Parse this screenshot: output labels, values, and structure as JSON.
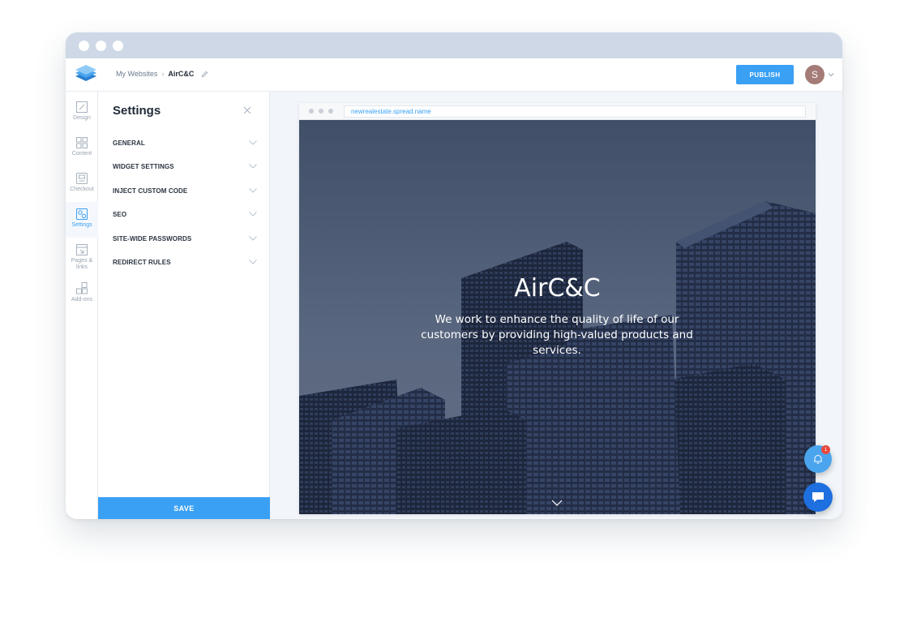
{
  "window": {
    "controls": [
      "close",
      "minimize",
      "maximize"
    ]
  },
  "topbar": {
    "logo_icon": "spread-logo-icon",
    "breadcrumb": {
      "root": "My Websites",
      "separator": "›",
      "current": "AirC&C",
      "edit_icon": "pencil-icon"
    },
    "publish_label": "PUBLISH",
    "avatar_initial": "S",
    "avatar_color": "#a47b76",
    "accent_color": "#3aa0f4"
  },
  "sidebar": {
    "items": [
      {
        "label": "Design",
        "icon": "design-icon",
        "active": false
      },
      {
        "label": "Content",
        "icon": "content-grid-icon",
        "active": false
      },
      {
        "label": "Checkout",
        "icon": "checkout-icon",
        "active": false
      },
      {
        "label": "Settings",
        "icon": "settings-gear-icon",
        "active": true
      },
      {
        "label": "Pages & links",
        "icon": "pages-icon",
        "active": false
      },
      {
        "label": "Add-ons",
        "icon": "addons-icon",
        "active": false
      }
    ]
  },
  "settings_panel": {
    "title": "Settings",
    "close_icon": "close-icon",
    "sections": [
      {
        "label": "GENERAL"
      },
      {
        "label": "WIDGET SETTINGS"
      },
      {
        "label": "INJECT CUSTOM CODE"
      },
      {
        "label": "SEO"
      },
      {
        "label": "SITE-WIDE PASSWORDS"
      },
      {
        "label": "REDIRECT RULES"
      }
    ],
    "save_label": "SAVE"
  },
  "preview": {
    "url": "newrealestate.spread.name",
    "hero_title": "AirC&C",
    "hero_subtitle": "We work to enhance the quality of life of our customers by providing high-valued products and services.",
    "scroll_icon": "chevron-down-icon"
  },
  "floating": {
    "notification_icon": "bell-icon",
    "notification_count": "1",
    "chat_icon": "chat-icon"
  }
}
